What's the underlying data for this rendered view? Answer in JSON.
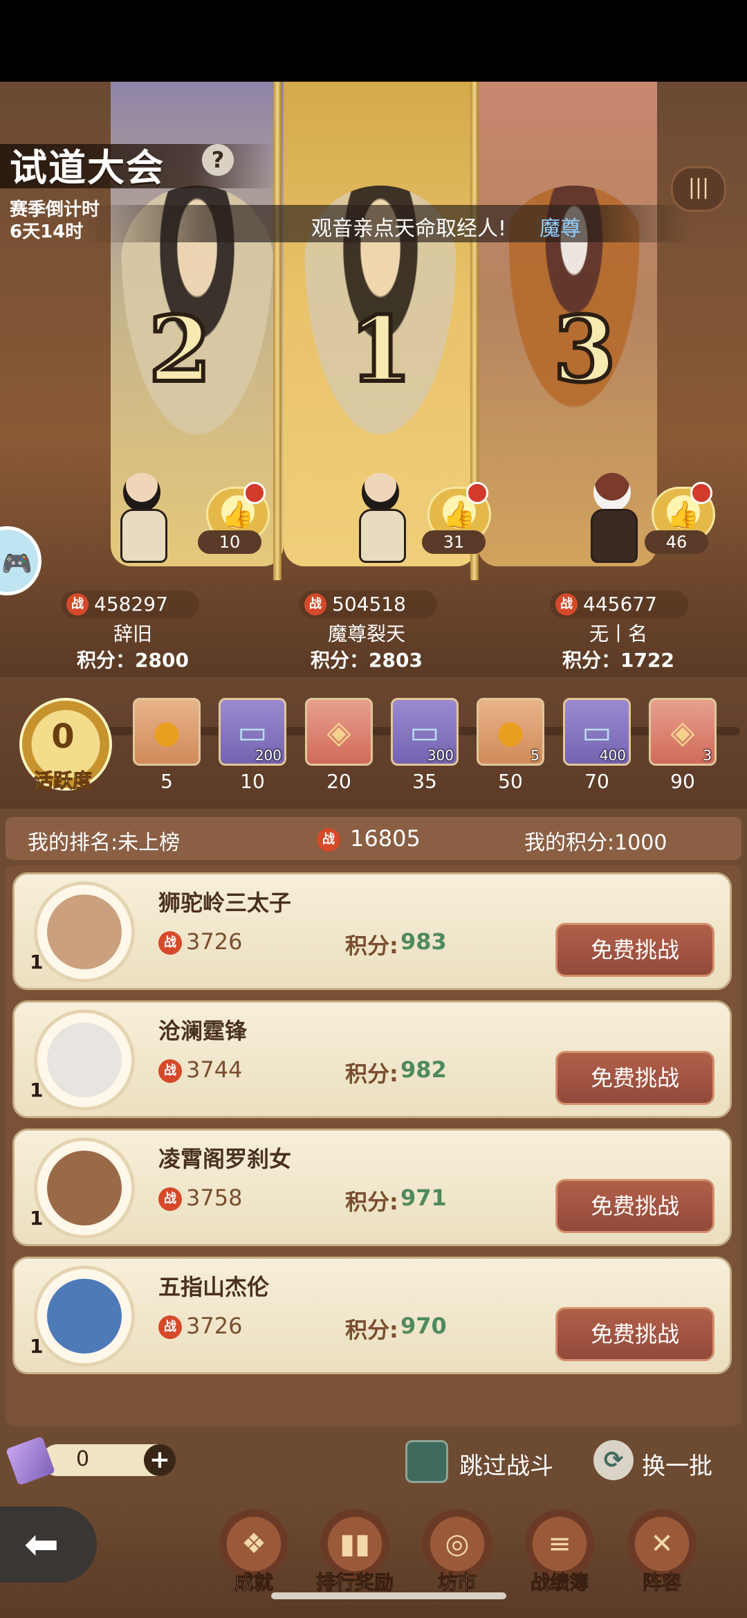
{
  "header": {
    "title": "试道大会",
    "help_glyph": "?",
    "season_label": "赛季倒计时",
    "season_time": "6天14时",
    "marquee_text": "观音亲点天命取经人!",
    "marquee_name": "魔尊",
    "rank_button_glyph": "|||"
  },
  "podium": [
    {
      "rank": "2",
      "likes": "10",
      "power": "458297",
      "name": "辞旧",
      "score": "积分：2800"
    },
    {
      "rank": "1",
      "likes": "31",
      "power": "504518",
      "name": "魔尊裂天",
      "score": "积分：2803"
    },
    {
      "rank": "3",
      "likes": "46",
      "power": "445677",
      "name": "无丨名",
      "score": "积分：1722"
    }
  ],
  "power_glyph": "战",
  "activity": {
    "value": "0",
    "label": "活跃度",
    "rewards": [
      {
        "type": "orange",
        "icon": "persimmon-icon",
        "qty": "",
        "threshold": "5"
      },
      {
        "type": "purple",
        "icon": "card-icon",
        "qty": "200",
        "threshold": "10"
      },
      {
        "type": "red",
        "icon": "token-icon",
        "qty": "",
        "threshold": "20"
      },
      {
        "type": "purple",
        "icon": "card-icon",
        "qty": "300",
        "threshold": "35"
      },
      {
        "type": "orange",
        "icon": "persimmon-icon",
        "qty": "5",
        "threshold": "50"
      },
      {
        "type": "purple",
        "icon": "card-icon",
        "qty": "400",
        "threshold": "70"
      },
      {
        "type": "red",
        "icon": "token-icon",
        "qty": "3",
        "threshold": "90"
      }
    ]
  },
  "my_stats": {
    "rank": "我的排名:未上榜",
    "power": "16805",
    "score": "我的积分:1000"
  },
  "opponents": [
    {
      "level": "1",
      "name": "狮驼岭三太子",
      "power": "3726",
      "score_label": "积分:",
      "score": "983",
      "button": "免费挑战",
      "face": "#caa07e"
    },
    {
      "level": "1",
      "name": "沧澜霆锋",
      "power": "3744",
      "score_label": "积分:",
      "score": "982",
      "button": "免费挑战",
      "face": "#e8e4e0"
    },
    {
      "level": "1",
      "name": "凌霄阁罗刹女",
      "power": "3758",
      "score_label": "积分:",
      "score": "971",
      "button": "免费挑战",
      "face": "#9a6a48"
    },
    {
      "level": "1",
      "name": "五指山杰伦",
      "power": "3726",
      "score_label": "积分:",
      "score": "970",
      "button": "免费挑战",
      "face": "#4f7ab8"
    }
  ],
  "controls": {
    "ticket_count": "0",
    "plus": "+",
    "skip_label": "跳过战斗",
    "refresh_label": "换一批",
    "refresh_glyph": "⟳"
  },
  "nav": [
    {
      "label": "成就",
      "glyph": "❖"
    },
    {
      "label": "排行奖励",
      "glyph": "▮▮"
    },
    {
      "label": "坊市",
      "glyph": "◎"
    },
    {
      "label": "战绩簿",
      "glyph": "≡"
    },
    {
      "label": "阵容",
      "glyph": "✕"
    }
  ],
  "back_glyph": "⬅",
  "colors": {
    "panel": "#6d4a32",
    "card": "#f7efd9",
    "challenge_button": "#a65545",
    "score_green": "#4f8a5e",
    "power_red": "#d54a2a"
  }
}
